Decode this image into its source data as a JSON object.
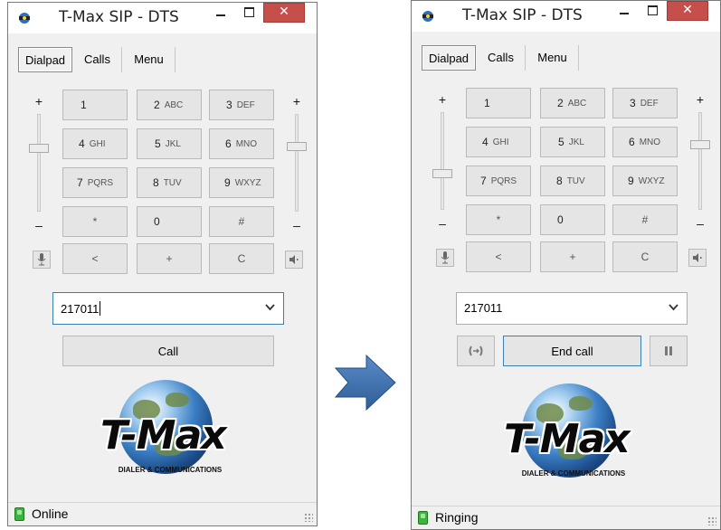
{
  "window_left": {
    "title": "T-Max SIP - DTS",
    "tabs": [
      {
        "label": "Dialpad"
      },
      {
        "label": "Calls"
      },
      {
        "label": "Menu"
      }
    ],
    "active_tab": "Dialpad",
    "slider_plus": "+",
    "slider_minus": "–",
    "keys": [
      {
        "num": "1",
        "letters": ""
      },
      {
        "num": "2",
        "letters": "ABC"
      },
      {
        "num": "3",
        "letters": "DEF"
      },
      {
        "num": "4",
        "letters": "GHI"
      },
      {
        "num": "5",
        "letters": "JKL"
      },
      {
        "num": "6",
        "letters": "MNO"
      },
      {
        "num": "7",
        "letters": "PQRS"
      },
      {
        "num": "8",
        "letters": "TUV"
      },
      {
        "num": "9",
        "letters": "WXYZ"
      },
      {
        "num": "*",
        "letters": ""
      },
      {
        "num": "0",
        "letters": ""
      },
      {
        "num": "#",
        "letters": ""
      },
      {
        "num": "<",
        "letters": ""
      },
      {
        "num": "+",
        "letters": ""
      },
      {
        "num": "C",
        "letters": ""
      }
    ],
    "number_input": {
      "value": "217011"
    },
    "call_button": "Call",
    "logo": {
      "brand": "T-Max",
      "tagline": "DIALER & COMMUNICATIONS"
    },
    "status": "Online"
  },
  "window_right": {
    "title": "T-Max SIP - DTS",
    "tabs": [
      {
        "label": "Dialpad"
      },
      {
        "label": "Calls"
      },
      {
        "label": "Menu"
      }
    ],
    "active_tab": "Dialpad",
    "slider_plus": "+",
    "slider_minus": "–",
    "keys": [
      {
        "num": "1",
        "letters": ""
      },
      {
        "num": "2",
        "letters": "ABC"
      },
      {
        "num": "3",
        "letters": "DEF"
      },
      {
        "num": "4",
        "letters": "GHI"
      },
      {
        "num": "5",
        "letters": "JKL"
      },
      {
        "num": "6",
        "letters": "MNO"
      },
      {
        "num": "7",
        "letters": "PQRS"
      },
      {
        "num": "8",
        "letters": "TUV"
      },
      {
        "num": "9",
        "letters": "WXYZ"
      },
      {
        "num": "*",
        "letters": ""
      },
      {
        "num": "0",
        "letters": ""
      },
      {
        "num": "#",
        "letters": ""
      },
      {
        "num": "<",
        "letters": ""
      },
      {
        "num": "+",
        "letters": ""
      },
      {
        "num": "C",
        "letters": ""
      }
    ],
    "number_input": {
      "value": "217011"
    },
    "end_call_button": "End call",
    "logo": {
      "brand": "T-Max",
      "tagline": "DIALER & COMMUNICATIONS"
    },
    "status": "Ringing"
  },
  "colors": {
    "close_button": "#c74f4b",
    "status_led": "#3db53d",
    "input_focus_border": "#3c7fb1",
    "active_call_border": "#3c7fb1",
    "arrow": "#3e6fa8"
  },
  "icons": {
    "app": "tmax-app-icon",
    "microphone": "microphone-icon",
    "speaker": "speaker-icon",
    "transfer": "call-transfer-icon",
    "hold": "pause-icon",
    "dropdown": "chevron-down-icon",
    "arrow": "right-arrow-icon"
  }
}
